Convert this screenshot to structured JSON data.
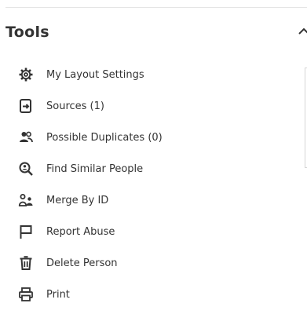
{
  "panel": {
    "title": "Tools",
    "collapse_icon": "chevron-up-icon"
  },
  "menu": {
    "items": [
      {
        "label": "My Layout Settings",
        "icon": "gear-icon"
      },
      {
        "label": "Sources (1)",
        "icon": "source-icon"
      },
      {
        "label": "Possible Duplicates (0)",
        "icon": "people-icon"
      },
      {
        "label": "Find Similar People",
        "icon": "search-person-icon"
      },
      {
        "label": "Merge By ID",
        "icon": "merge-icon"
      },
      {
        "label": "Report Abuse",
        "icon": "flag-icon"
      },
      {
        "label": "Delete Person",
        "icon": "trash-icon"
      },
      {
        "label": "Print",
        "icon": "printer-icon"
      }
    ]
  },
  "colors": {
    "text": "#333333",
    "icon": "#333333",
    "divider": "#e5e5e5"
  }
}
